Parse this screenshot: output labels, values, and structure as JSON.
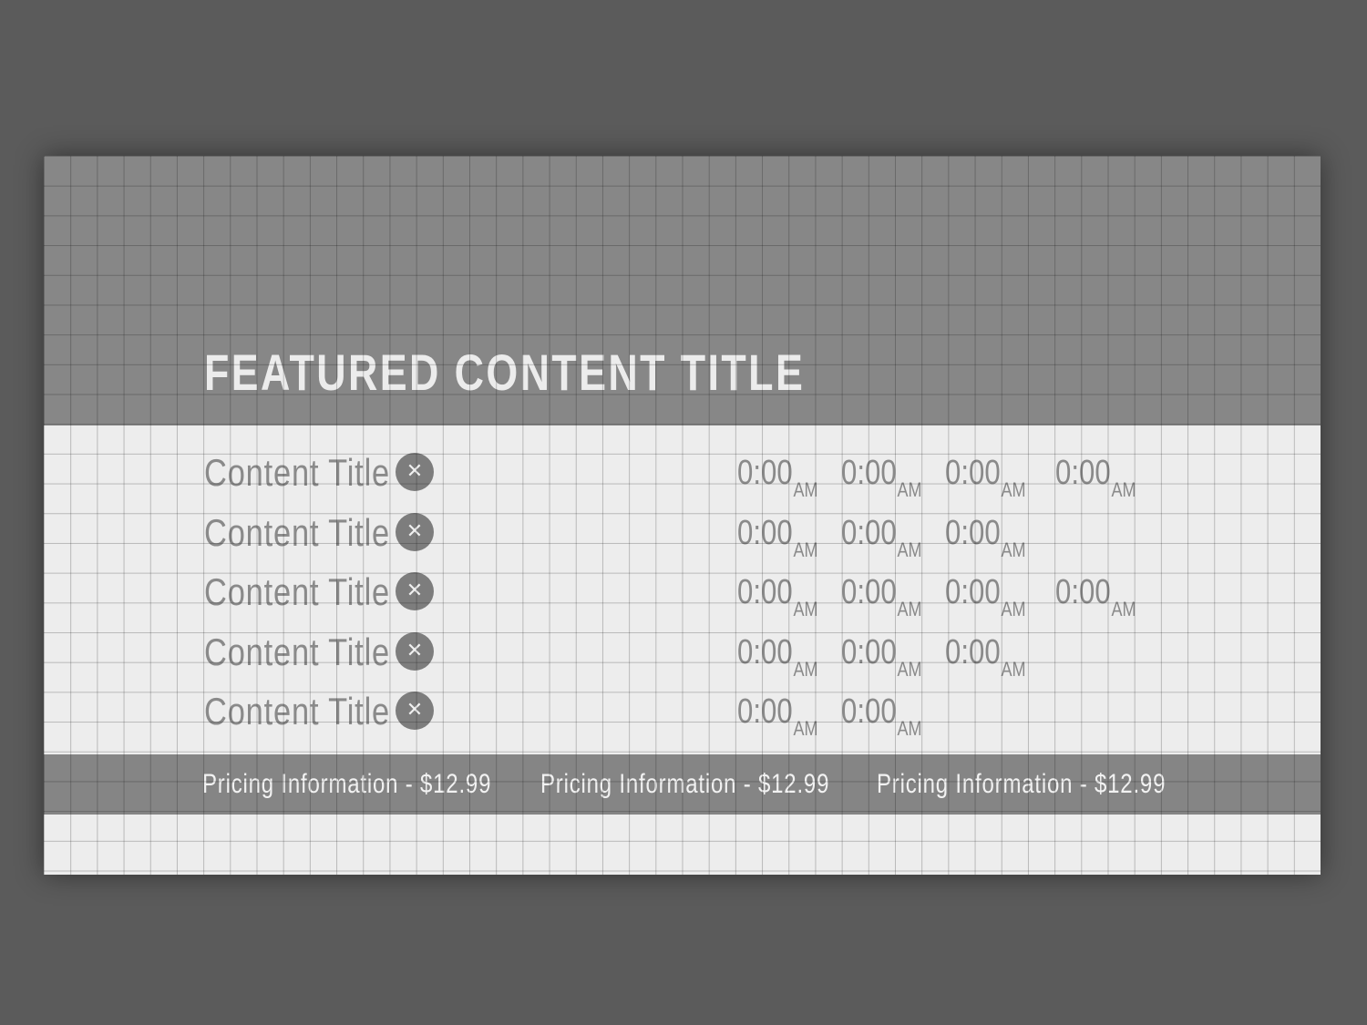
{
  "featured": {
    "title": "FEATURED CONTENT TITLE"
  },
  "rows": [
    {
      "title": "Content Title",
      "remove_icon": "close-icon",
      "times": [
        {
          "time": "0:00",
          "period": "AM"
        },
        {
          "time": "0:00",
          "period": "AM"
        },
        {
          "time": "0:00",
          "period": "AM"
        },
        {
          "time": "0:00",
          "period": "AM"
        }
      ]
    },
    {
      "title": "Content Title",
      "remove_icon": "close-icon",
      "times": [
        {
          "time": "0:00",
          "period": "AM"
        },
        {
          "time": "0:00",
          "period": "AM"
        },
        {
          "time": "0:00",
          "period": "AM"
        }
      ]
    },
    {
      "title": "Content Title",
      "remove_icon": "close-icon",
      "times": [
        {
          "time": "0:00",
          "period": "AM"
        },
        {
          "time": "0:00",
          "period": "AM"
        },
        {
          "time": "0:00",
          "period": "AM"
        },
        {
          "time": "0:00",
          "period": "AM"
        }
      ]
    },
    {
      "title": "Content Title",
      "remove_icon": "close-icon",
      "times": [
        {
          "time": "0:00",
          "period": "AM"
        },
        {
          "time": "0:00",
          "period": "AM"
        },
        {
          "time": "0:00",
          "period": "AM"
        }
      ]
    },
    {
      "title": "Content Title",
      "remove_icon": "close-icon",
      "times": [
        {
          "time": "0:00",
          "period": "AM"
        },
        {
          "time": "0:00",
          "period": "AM"
        }
      ]
    }
  ],
  "pricing": [
    "Pricing Information - $12.99",
    "Pricing Information - $12.99",
    "Pricing Information - $12.99"
  ],
  "colors": {
    "page_background": "#5b5b5b",
    "hero_background": "#878787",
    "list_background": "#ededed",
    "pricing_bar": "#858585",
    "title_text": "#ececec",
    "muted_text": "#8a8a8a"
  }
}
